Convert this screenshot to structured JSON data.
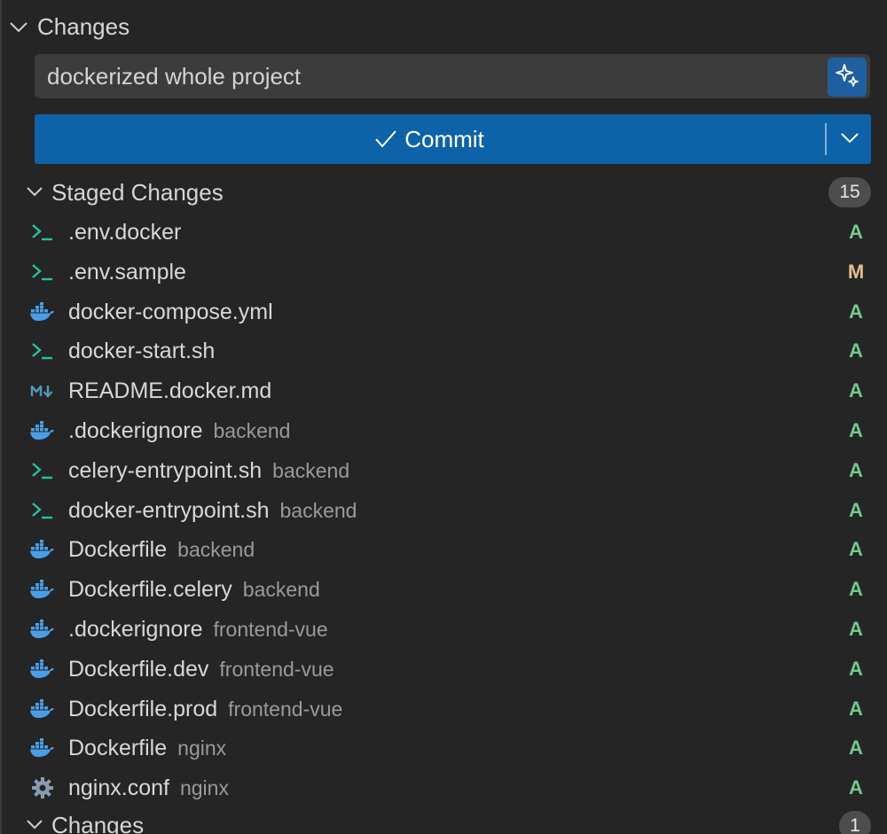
{
  "changes_section": {
    "title": "Changes"
  },
  "commit_message": {
    "value": "dockerized whole project"
  },
  "commit_button": {
    "label": "Commit"
  },
  "staged_section": {
    "title": "Staged Changes",
    "count": "15"
  },
  "staged_files": [
    {
      "name": ".env.docker",
      "dir": "",
      "status": "A",
      "icon": "terminal-icon"
    },
    {
      "name": ".env.sample",
      "dir": "",
      "status": "M",
      "icon": "terminal-icon"
    },
    {
      "name": "docker-compose.yml",
      "dir": "",
      "status": "A",
      "icon": "docker-icon"
    },
    {
      "name": "docker-start.sh",
      "dir": "",
      "status": "A",
      "icon": "terminal-icon"
    },
    {
      "name": "README.docker.md",
      "dir": "",
      "status": "A",
      "icon": "markdown-icon"
    },
    {
      "name": ".dockerignore",
      "dir": "backend",
      "status": "A",
      "icon": "docker-icon"
    },
    {
      "name": "celery-entrypoint.sh",
      "dir": "backend",
      "status": "A",
      "icon": "terminal-icon"
    },
    {
      "name": "docker-entrypoint.sh",
      "dir": "backend",
      "status": "A",
      "icon": "terminal-icon"
    },
    {
      "name": "Dockerfile",
      "dir": "backend",
      "status": "A",
      "icon": "docker-icon"
    },
    {
      "name": "Dockerfile.celery",
      "dir": "backend",
      "status": "A",
      "icon": "docker-icon"
    },
    {
      "name": ".dockerignore",
      "dir": "frontend-vue",
      "status": "A",
      "icon": "docker-icon"
    },
    {
      "name": "Dockerfile.dev",
      "dir": "frontend-vue",
      "status": "A",
      "icon": "docker-icon"
    },
    {
      "name": "Dockerfile.prod",
      "dir": "frontend-vue",
      "status": "A",
      "icon": "docker-icon"
    },
    {
      "name": "Dockerfile",
      "dir": "nginx",
      "status": "A",
      "icon": "docker-icon"
    },
    {
      "name": "nginx.conf",
      "dir": "nginx",
      "status": "A",
      "icon": "gear-icon"
    }
  ],
  "changes_section_2": {
    "title": "Changes",
    "count": "1"
  },
  "colors": {
    "added": "#73c991",
    "modified": "#e2c08d",
    "terminal_icon": "#25c2a0",
    "docker_icon": "#4a9ee8",
    "markdown_icon": "#519aba",
    "gear_icon": "#8a9bb0",
    "commit_button_bg": "#0e63a8"
  }
}
